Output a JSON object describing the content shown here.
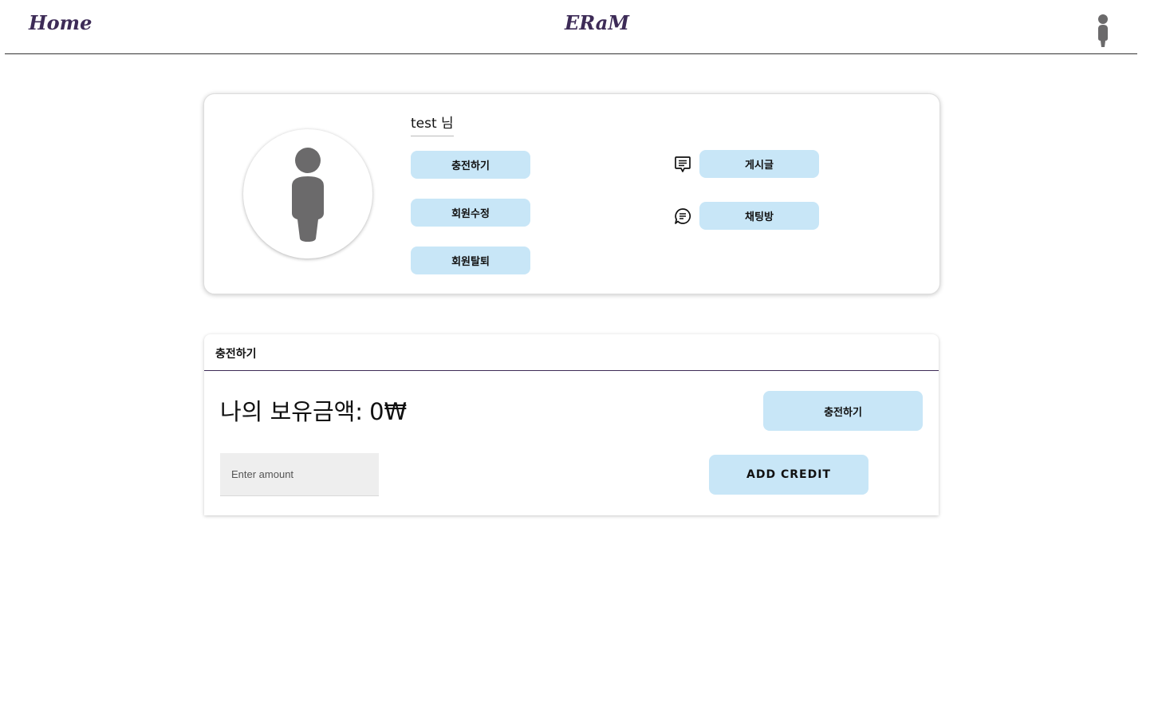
{
  "header": {
    "home_label": "Home",
    "brand": "ERaM",
    "user_icon": "person-icon"
  },
  "profile": {
    "avatar_icon": "person-icon",
    "username": "test 님",
    "actions": {
      "charge": "충전하기",
      "edit_member": "회원수정",
      "withdraw": "회원탈퇴",
      "posts": "게시글",
      "chatroom": "채팅방"
    },
    "icons": {
      "posts": "message-square-icon",
      "chatroom": "chat-bubble-icon"
    }
  },
  "charge_panel": {
    "title": "충전하기",
    "balance_label": "나의 보유금액:",
    "balance_value": "0₩",
    "charge_button": "충전하기",
    "amount_placeholder": "Enter amount",
    "amount_value": "",
    "add_credit_button": "ADD CREDIT"
  },
  "colors": {
    "accent": "#3d2b57",
    "button_bg": "#c8e6f7",
    "icon_gray": "#6b6a6b"
  }
}
